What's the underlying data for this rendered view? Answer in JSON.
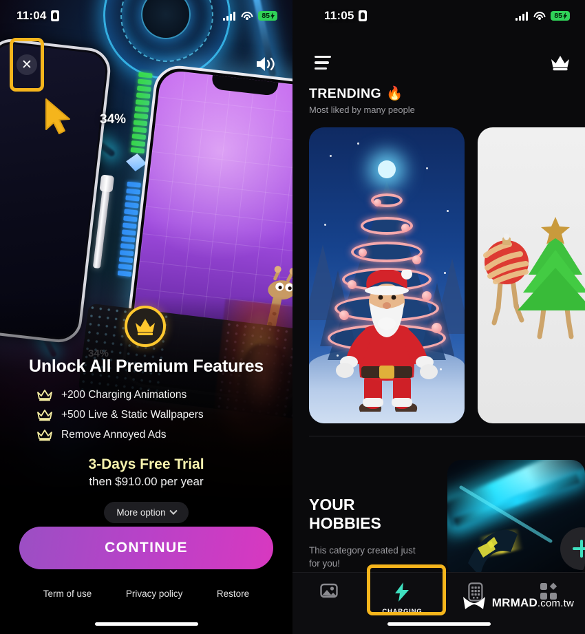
{
  "left_panel": {
    "status_bar": {
      "time": "11:04",
      "battery": "85",
      "recording_icon": "screen-recording-icon",
      "signal_icon": "cellular-bars-icon",
      "wifi_icon": "wifi-icon"
    },
    "close_button": {
      "glyph": "✕",
      "name": "close-icon",
      "highlighted": true,
      "highlight_color": "#f5b51c"
    },
    "cursor": {
      "name": "pointer-cursor",
      "color": "#f5b51c"
    },
    "volume_icon": "speaker-volume-icon",
    "charging_percent": "34%",
    "charging_percent_ghost": "34%",
    "premium_badge_icon": "crown-badge-icon",
    "paywall": {
      "title": "Unlock All Premium Features",
      "features": [
        {
          "icon": "crown-icon",
          "label": "+200 Charging Animations"
        },
        {
          "icon": "crown-icon",
          "label": "+500 Live & Static Wallpapers"
        },
        {
          "icon": "crown-icon",
          "label": "Remove Annoyed Ads"
        }
      ],
      "trial": "3-Days Free Trial",
      "price": "then $910.00 per year",
      "more_option": "More option",
      "more_option_icon": "chevron-down-icon",
      "continue": "CONTINUE",
      "continue_gradient_from": "#9b4fc4",
      "continue_gradient_to": "#d838c0",
      "links": [
        "Term of use",
        "Privacy policy",
        "Restore"
      ]
    }
  },
  "right_panel": {
    "status_bar": {
      "time": "11:05",
      "battery": "85",
      "recording_icon": "screen-recording-icon",
      "signal_icon": "cellular-bars-icon",
      "wifi_icon": "wifi-icon"
    },
    "header": {
      "menu_icon": "hamburger-menu-icon",
      "premium_icon": "crown-icon"
    },
    "trending": {
      "title": "TRENDING",
      "title_emoji": "🔥",
      "subtitle": "Most liked by many people",
      "cards": [
        {
          "name": "santa-christmas-tree-wallpaper"
        },
        {
          "name": "christmas-ornaments-wallpaper"
        }
      ]
    },
    "hobbies": {
      "title_line1": "YOUR",
      "title_line2": "HOBBIES",
      "subtitle": "This category created just for you!",
      "card_name": "neon-lightning-wallpaper",
      "add_button_icon": "plus-icon",
      "add_button_color": "#3fe0c0"
    },
    "tabbar": {
      "active_index": 1,
      "highlight_color": "#f5b51c",
      "items": [
        {
          "icon": "wallpaper-image-icon",
          "label": ""
        },
        {
          "icon": "charging-bolt-icon",
          "label": "CHARGING"
        },
        {
          "icon": "phone-widget-icon",
          "label": ""
        },
        {
          "icon": "grid-apps-icon",
          "label": ""
        }
      ]
    },
    "watermark": {
      "logo": "mrmad-logo-icon",
      "brand": "MRMAD",
      "domain": ".com.tw"
    }
  }
}
